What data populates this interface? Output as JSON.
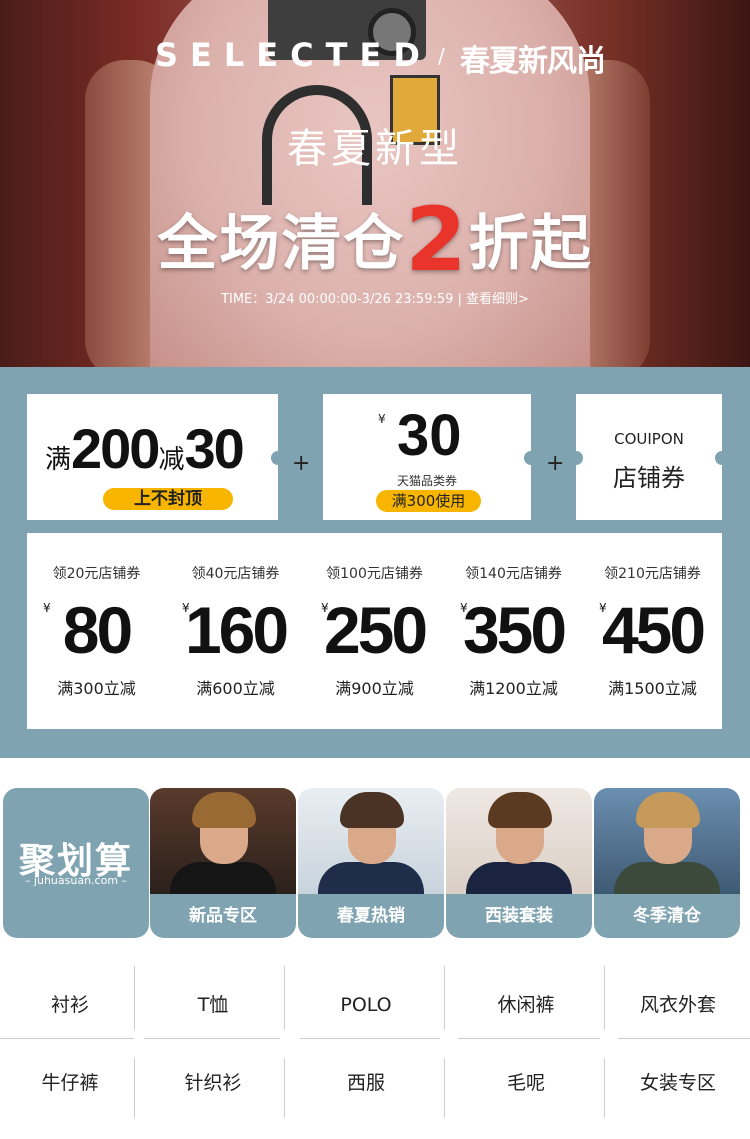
{
  "hero": {
    "brand": "SELECTED",
    "brand_separator": "/",
    "brand_tagline": "春夏新风尚",
    "title_line1": "春夏新型",
    "title_line2_prefix": "全场清仓",
    "title_line2_highlight": "2",
    "title_line2_suffix": "折起",
    "time_text": "TIME：3/24 00:00:00-3/26 23:59:59 | 查看细则>",
    "highlight_color": "#e8342b"
  },
  "coupons": {
    "accent_color": "#7fa3b1",
    "pill_color": "#f7b500",
    "full_reduction": {
      "prefix": "满",
      "threshold": "200",
      "middle": "减",
      "amount": "30",
      "badge": "上不封顶"
    },
    "plus_sign": "+",
    "tmall": {
      "currency": "¥",
      "amount": "30",
      "label": "天猫品类券",
      "badge": "满300使用"
    },
    "shop": {
      "en_label": "COUIPON",
      "cn_label": "店铺券"
    },
    "tiers": [
      {
        "label": "领20元店铺券",
        "currency": "¥",
        "amount": "80",
        "condition": "满300立减"
      },
      {
        "label": "领40元店铺券",
        "currency": "¥",
        "amount": "160",
        "condition": "满600立减"
      },
      {
        "label": "领100元店铺券",
        "currency": "¥",
        "amount": "250",
        "condition": "满900立减"
      },
      {
        "label": "领140元店铺券",
        "currency": "¥",
        "amount": "350",
        "condition": "满1200立减"
      },
      {
        "label": "领210元店铺券",
        "currency": "¥",
        "amount": "450",
        "condition": "满1500立减"
      }
    ]
  },
  "categories": {
    "juhuasuan": {
      "logo": "聚划算",
      "sub": "– juhuasuan.com –"
    },
    "tiles": [
      {
        "label": "新品专区",
        "icon": "model-photo"
      },
      {
        "label": "春夏热销",
        "icon": "model-photo"
      },
      {
        "label": "西装套装",
        "icon": "model-photo"
      },
      {
        "label": "冬季清仓",
        "icon": "model-photo"
      }
    ]
  },
  "subcategories": {
    "row1": [
      "衬衫",
      "T恤",
      "POLO",
      "休闲裤",
      "风衣外套"
    ],
    "row2": [
      "牛仔裤",
      "针织衫",
      "西服",
      "毛呢",
      "女装专区"
    ]
  }
}
